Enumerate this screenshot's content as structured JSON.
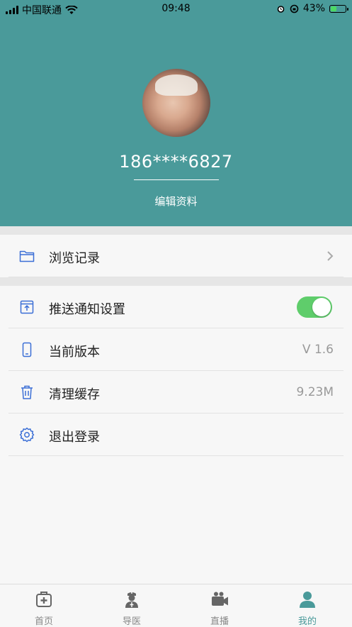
{
  "status_bar": {
    "carrier": "中国联通",
    "time": "09:48",
    "battery_percent": "43%",
    "battery_level": 0.43
  },
  "profile": {
    "phone": "186****6827",
    "edit_label": "编辑资料"
  },
  "menu": {
    "history": {
      "label": "浏览记录",
      "icon": "folder-icon"
    },
    "push": {
      "label": "推送通知设置",
      "icon": "upload-box-icon",
      "enabled": true
    },
    "version": {
      "label": "当前版本",
      "value": "V 1.6",
      "icon": "phone-icon"
    },
    "cache": {
      "label": "清理缓存",
      "value": "9.23M",
      "icon": "trash-icon"
    },
    "logout": {
      "label": "退出登录",
      "icon": "gear-icon"
    }
  },
  "tabs": [
    {
      "label": "首页",
      "icon": "medical-kit-icon",
      "active": false
    },
    {
      "label": "导医",
      "icon": "nurse-icon",
      "active": false
    },
    {
      "label": "直播",
      "icon": "video-camera-icon",
      "active": false
    },
    {
      "label": "我的",
      "icon": "user-icon",
      "active": true
    }
  ],
  "colors": {
    "header_bg": "#4a9a9a",
    "accent": "#4a9a9a",
    "icon_blue": "#3b6fd6",
    "toggle_on": "#5fcd6b"
  }
}
